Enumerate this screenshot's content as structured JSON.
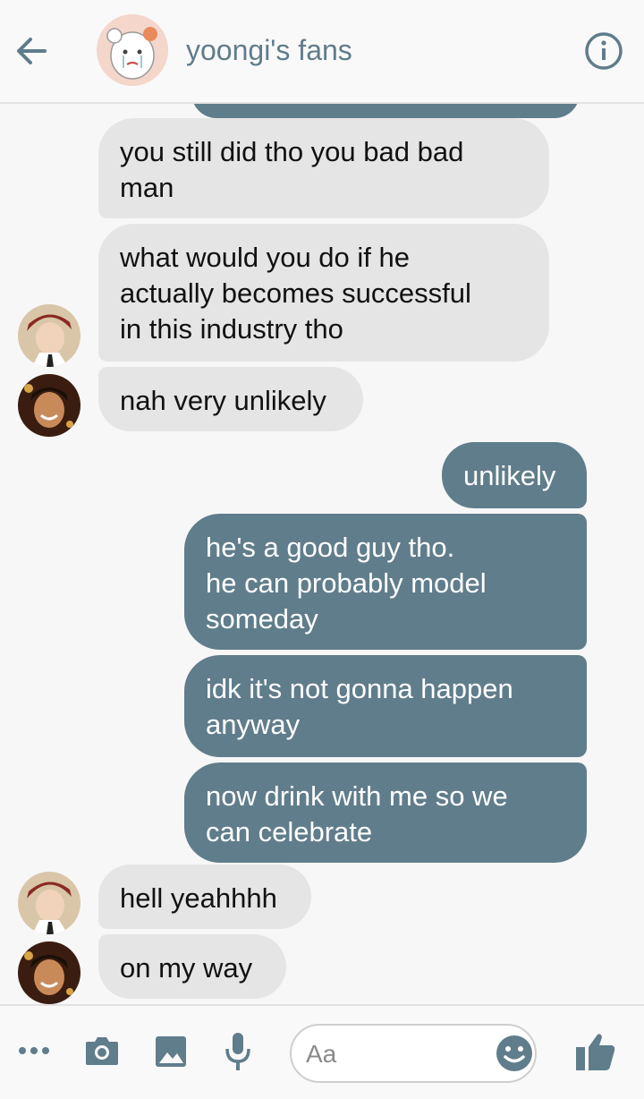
{
  "header": {
    "title": "yoongi's fans",
    "back_icon": "arrow-left-icon",
    "info_icon": "info-circle-icon"
  },
  "colors": {
    "accent": "#607d8b",
    "incoming_bubble": "#e5e5e5",
    "outgoing_bubble": "#607d8b",
    "title": "#5f7c8c"
  },
  "messages": [
    {
      "side": "in",
      "sender": "rm",
      "text": "you still did tho you bad bad\nman"
    },
    {
      "side": "in",
      "sender": "jin",
      "text": "what would you do if he\nactually becomes successful\nin this industry tho"
    },
    {
      "side": "in",
      "sender": "rm",
      "text": "nah very unlikely"
    },
    {
      "side": "out",
      "text": "unlikely"
    },
    {
      "side": "out",
      "text": "he's a good guy tho.\nhe can probably model\nsomeday"
    },
    {
      "side": "out",
      "text": "idk it's not gonna happen\nanyway"
    },
    {
      "side": "out",
      "text": "now drink with me so we\ncan celebrate"
    },
    {
      "side": "in",
      "sender": "jin",
      "text": "hell yeahhhh"
    },
    {
      "side": "in",
      "sender": "rm",
      "text": "on my way"
    }
  ],
  "composer": {
    "placeholder": "Aa",
    "icons": [
      "more-icon",
      "camera-icon",
      "image-icon",
      "microphone-icon",
      "emoji-icon",
      "thumbs-up-icon"
    ]
  }
}
